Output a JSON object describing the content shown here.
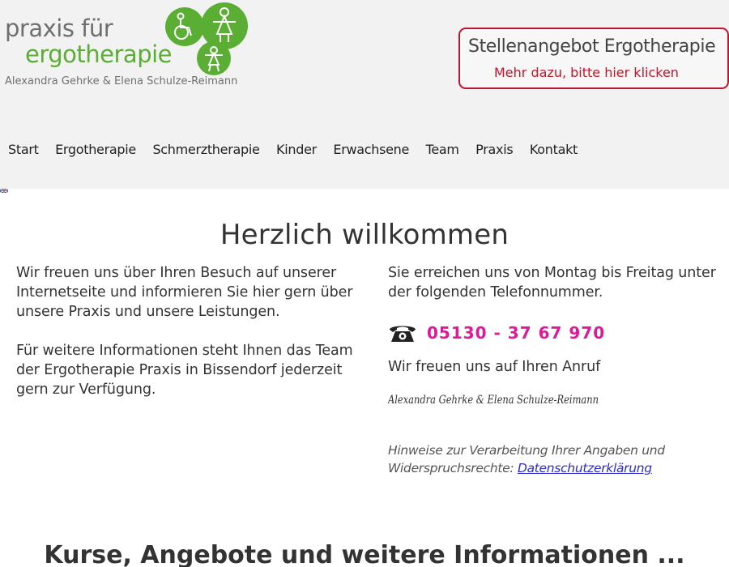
{
  "header": {
    "logo": {
      "line1": "praxis für",
      "line2": "ergotherapie",
      "line3": "Alexandra Gehrke & Elena Schulze-Reimann"
    },
    "job_banner": {
      "title": "Stellenangebot Ergotherapie",
      "subtitle": "Mehr dazu, bitte hier klicken"
    },
    "nav": [
      {
        "label": "Start"
      },
      {
        "label": "Ergotherapie"
      },
      {
        "label": "Schmerztherapie"
      },
      {
        "label": "Kinder"
      },
      {
        "label": "Erwachsene"
      },
      {
        "label": "Team"
      },
      {
        "label": "Praxis"
      },
      {
        "label": "Kontakt"
      }
    ],
    "flag_icon": "uk-flag-icon"
  },
  "main": {
    "title": "Herzlich willkommen",
    "left": {
      "paragraph1": "Wir freuen uns über Ihren Besuch auf unserer Internetseite und informieren Sie hier gern über unsere Praxis und unsere Leistungen.",
      "paragraph2": "Für weitere Informationen steht Ihnen das Team der Ergotherapie Praxis in Bissendorf jederzeit gern zur Verfügung."
    },
    "right": {
      "intro": "Sie erreichen uns von Montag bis Freitag unter der folgenden Telefonnummer.",
      "phone": "05130 - 37 67 970",
      "phone_icon": "telephone-icon",
      "call_text": "Wir freuen uns auf Ihren Anruf",
      "signature": "Alexandra Gehrke & Elena Schulze-Reimann",
      "privacy_text": "Hinweise zur Verarbeitung Ihrer Angaben und Widerspruchsrechte: ",
      "privacy_link": "Datenschutzerklärung"
    }
  },
  "courses": {
    "title": "Kurse, Angebote und weitere Informationen ..."
  },
  "colors": {
    "header_bg": "#f2f2f2",
    "logo_green": "#5aae33",
    "banner_red": "#c0152b",
    "phone_pink": "#e0199b",
    "link_blue": "#2b2bd6"
  }
}
